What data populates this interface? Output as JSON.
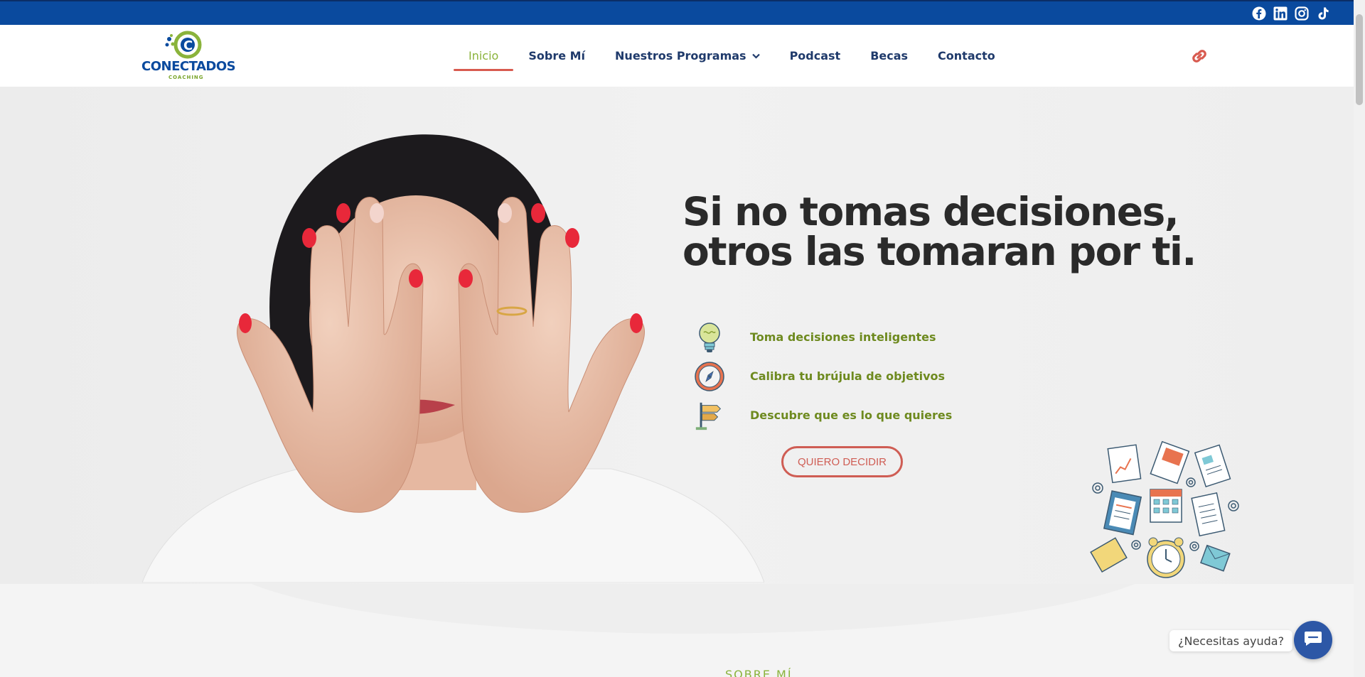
{
  "social": {
    "icons": [
      "facebook-icon",
      "linkedin-icon",
      "instagram-icon",
      "tiktok-icon"
    ]
  },
  "logo": {
    "title": "CONECTADOS",
    "subtitle": "COACHING"
  },
  "nav": {
    "items": [
      {
        "label": "Inicio",
        "active": true
      },
      {
        "label": "Sobre Mí"
      },
      {
        "label": "Nuestros Programas",
        "has_dropdown": true
      },
      {
        "label": "Podcast"
      },
      {
        "label": "Becas"
      },
      {
        "label": "Contacto"
      }
    ]
  },
  "hero": {
    "headline_line1": "Si no tomas decisiones,",
    "headline_line2": "otros las tomaran por ti.",
    "features": [
      {
        "icon": "lightbulb-icon",
        "text": "Toma decisiones inteligentes"
      },
      {
        "icon": "compass-icon",
        "text": "Calibra tu brújula de objetivos"
      },
      {
        "icon": "signpost-icon",
        "text": "Descubre que es lo que quieres"
      }
    ],
    "cta_label": "QUIERO DECIDIR"
  },
  "sobre": {
    "heading": "SOBRE MÍ"
  },
  "chat": {
    "bubble_text": "¿Necesitas ayuda?"
  },
  "colors": {
    "topbar": "#0a4a9e",
    "brand_blue": "#1f3a6b",
    "brand_green": "#8ab33b",
    "accent_red": "#cf5d54",
    "feature_green": "#6e8a1f"
  }
}
